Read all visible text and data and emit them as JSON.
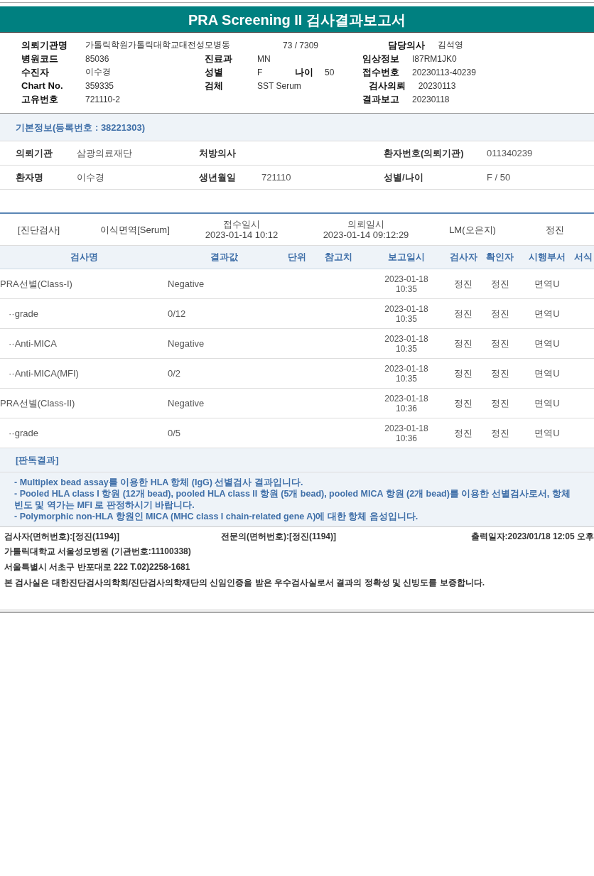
{
  "title": "PRA Screening II 검사결과보고서",
  "header_rows": [
    {
      "left": {
        "label": "의뢰기관명",
        "value": "가톨릭학원가톨릭대학교대전성모병동"
      },
      "middle": {
        "value": "73 / 7309"
      },
      "right": {
        "label": "담당의사",
        "value": "김석영"
      }
    },
    {
      "left": {
        "label": "병원코드",
        "value": "85036"
      },
      "middle": {
        "label": "진료과",
        "value": "MN"
      },
      "right": {
        "label": "임상정보",
        "value": "I87RM1JK0"
      }
    },
    {
      "left": {
        "label": "수진자",
        "value": "이수경"
      },
      "middle": {
        "label": "성별",
        "value": "F"
      },
      "extra": {
        "label": "나이",
        "value": "50"
      },
      "right": {
        "label": "접수번호",
        "value": "20230113-40239"
      }
    },
    {
      "left": {
        "label": "Chart No.",
        "value": "359335"
      },
      "middle": {
        "label": "검체",
        "value": "SST Serum"
      },
      "right": {
        "label": "검사의뢰",
        "value": "20230113"
      }
    },
    {
      "left": {
        "label": "고유번호",
        "value": "721110-2"
      },
      "right": {
        "label": "결과보고",
        "value": "20230118"
      }
    }
  ],
  "basic_info": {
    "title": "기본정보(등록번호 : 38221303)",
    "rows": [
      [
        {
          "label": "의뢰기관",
          "value": "삼광의료재단"
        },
        {
          "label": "처방의사"
        },
        {
          "label": "환자번호(의뢰기관)",
          "value": "011340239"
        }
      ],
      [
        {
          "label": "환자명",
          "value": "이수경"
        },
        {
          "label": "생년월일",
          "value": "721110"
        },
        {
          "label": "성별/나이",
          "value": "F / 50"
        }
      ]
    ]
  },
  "order": [
    {
      "value": "[진단검사]"
    },
    {
      "value": "이식면역[Serum]"
    },
    {
      "label": "접수일시",
      "value": "2023-01-14 10:12"
    },
    {
      "label": "의뢰일시",
      "value": "2023-01-14 09:12:29"
    },
    {
      "value": "LM(오은지)"
    },
    {
      "value": "정진"
    }
  ],
  "results": {
    "columns": [
      "검사명",
      "결과값",
      "단위",
      "참고치",
      "보고일시",
      "검사자",
      "확인자",
      "시행부서",
      "서식"
    ],
    "rows": [
      {
        "name": "PRA선별(Class-I)",
        "result": "Negative",
        "date": "2023-01-18",
        "time": "10:35",
        "tester": "정진",
        "confirmer": "정진",
        "dept": "면역U",
        "children": [
          {
            "name": "··grade",
            "result": "0/12",
            "date": "2023-01-18",
            "time": "10:35",
            "tester": "정진",
            "confirmer": "정진",
            "dept": "면역U"
          },
          {
            "name": "··Anti-MICA",
            "result": "Negative",
            "date": "2023-01-18",
            "time": "10:35",
            "tester": "정진",
            "confirmer": "정진",
            "dept": "면역U"
          },
          {
            "name": "··Anti-MICA(MFI)",
            "result": "0/2",
            "date": "2023-01-18",
            "time": "10:35",
            "tester": "정진",
            "confirmer": "정진",
            "dept": "면역U"
          }
        ]
      },
      {
        "name": "PRA선별(Class-II)",
        "result": "Negative",
        "date": "2023-01-18",
        "time": "10:36",
        "tester": "정진",
        "confirmer": "정진",
        "dept": "면역U",
        "children": [
          {
            "name": "··grade",
            "result": "0/5",
            "date": "2023-01-18",
            "time": "10:36",
            "tester": "정진",
            "confirmer": "정진",
            "dept": "면역U"
          }
        ]
      }
    ]
  },
  "interpretation": {
    "title": "[판독결과]",
    "lines": [
      "- Multiplex bead assay를 이용한 HLA 항체 (IgG) 선별검사 결과입니다.",
      "- Pooled HLA class I 항원 (12개 bead), pooled HLA class II 항원 (5개 bead), pooled MICA 항원 (2개 bead)를 이용한 선별검사로서, 항체빈도 및 역가는 MFI 로 판정하시기 바랍니다.",
      "- Polymorphic non-HLA 항원인 MICA (MHC class I chain-related gene A)에 대한 항체 음성입니다."
    ]
  },
  "signatures": [
    "검사자(면허번호):[정진(1194)]",
    "전문의(면허번호):[정진(1194)]",
    "출력일자:2023/01/18 12:05 오후"
  ],
  "footer_lines": [
    "가톨릭대학교 서울성모병원 (기관번호:11100338)",
    "서울특별시 서초구 반포대로 222 T.02)2258-1681",
    "본 검사실은 대한진단검사의학회/진단검사의학재단의 신임인증을 받은 우수검사실로서 결과의 정확성 및 신빙도를 보증합니다."
  ]
}
